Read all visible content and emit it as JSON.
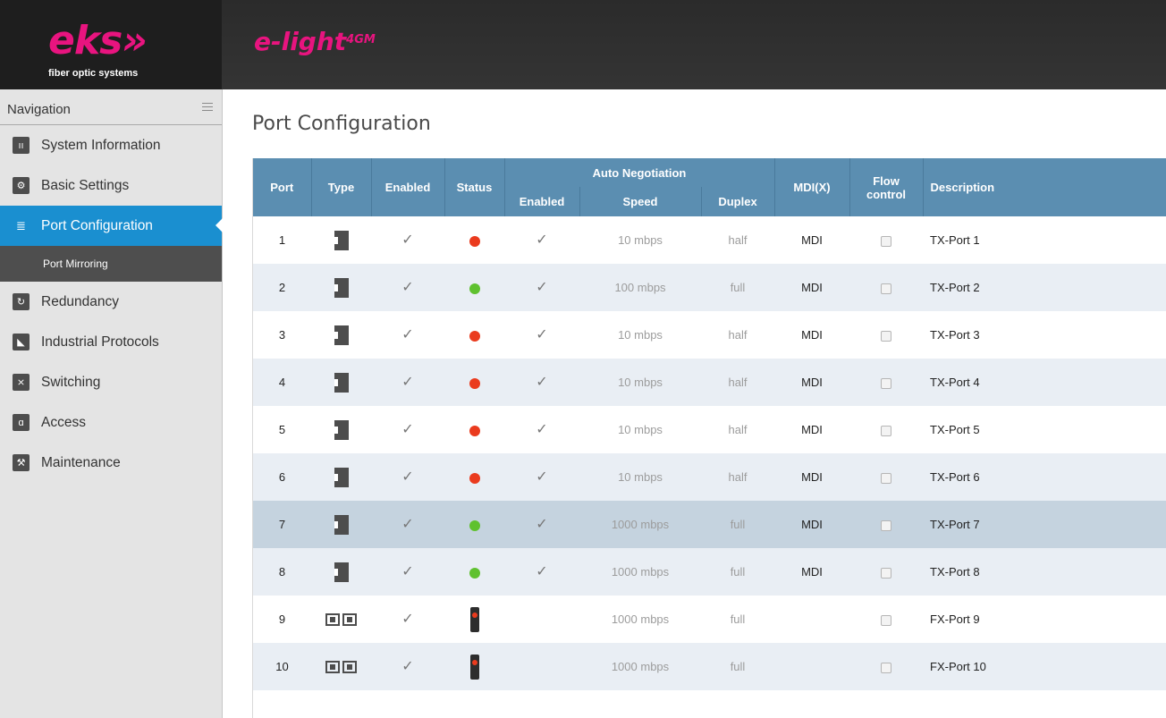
{
  "header": {
    "brand_logo": "eks»",
    "brand_subtitle": "fiber optic systems",
    "product_name": "e-light",
    "product_suffix": "4GM"
  },
  "sidebar": {
    "title": "Navigation",
    "items": [
      {
        "label": "System Information",
        "icon": "chart-icon"
      },
      {
        "label": "Basic Settings",
        "icon": "gear-icon"
      },
      {
        "label": "Port Configuration",
        "icon": "port-config-icon",
        "active": true
      },
      {
        "label": "Port Mirroring",
        "icon": "",
        "sub": true
      },
      {
        "label": "Redundancy",
        "icon": "redundancy-icon"
      },
      {
        "label": "Industrial Protocols",
        "icon": "protocols-icon"
      },
      {
        "label": "Switching",
        "icon": "switching-icon"
      },
      {
        "label": "Access",
        "icon": "lock-icon"
      },
      {
        "label": "Maintenance",
        "icon": "wrench-icon"
      }
    ]
  },
  "main": {
    "title": "Port Configuration",
    "columns": {
      "port": "Port",
      "type": "Type",
      "enabled": "Enabled",
      "status": "Status",
      "auto_negotiation": "Auto Negotiation",
      "an_enabled": "Enabled",
      "speed": "Speed",
      "duplex": "Duplex",
      "mdix": "MDI(X)",
      "flow_line1": "Flow",
      "flow_line2": "control",
      "description": "Description"
    },
    "rows": [
      {
        "port": "1",
        "type": "TX",
        "enabled": true,
        "status": "down",
        "an_enabled": true,
        "speed": "10 mbps",
        "duplex": "half",
        "mdix": "MDI",
        "flow": false,
        "description": "TX-Port 1"
      },
      {
        "port": "2",
        "type": "TX",
        "enabled": true,
        "status": "up",
        "an_enabled": true,
        "speed": "100 mbps",
        "duplex": "full",
        "mdix": "MDI",
        "flow": false,
        "description": "TX-Port 2"
      },
      {
        "port": "3",
        "type": "TX",
        "enabled": true,
        "status": "down",
        "an_enabled": true,
        "speed": "10 mbps",
        "duplex": "half",
        "mdix": "MDI",
        "flow": false,
        "description": "TX-Port 3"
      },
      {
        "port": "4",
        "type": "TX",
        "enabled": true,
        "status": "down",
        "an_enabled": true,
        "speed": "10 mbps",
        "duplex": "half",
        "mdix": "MDI",
        "flow": false,
        "description": "TX-Port 4"
      },
      {
        "port": "5",
        "type": "TX",
        "enabled": true,
        "status": "down",
        "an_enabled": true,
        "speed": "10 mbps",
        "duplex": "half",
        "mdix": "MDI",
        "flow": false,
        "description": "TX-Port 5"
      },
      {
        "port": "6",
        "type": "TX",
        "enabled": true,
        "status": "down",
        "an_enabled": true,
        "speed": "10 mbps",
        "duplex": "half",
        "mdix": "MDI",
        "flow": false,
        "description": "TX-Port 6"
      },
      {
        "port": "7",
        "type": "TX",
        "enabled": true,
        "status": "up",
        "an_enabled": true,
        "speed": "1000 mbps",
        "duplex": "full",
        "mdix": "MDI",
        "flow": false,
        "description": "TX-Port 7",
        "selected": true
      },
      {
        "port": "8",
        "type": "TX",
        "enabled": true,
        "status": "up",
        "an_enabled": true,
        "speed": "1000 mbps",
        "duplex": "full",
        "mdix": "MDI",
        "flow": false,
        "description": "TX-Port 8"
      },
      {
        "port": "9",
        "type": "FX",
        "enabled": true,
        "status": "sfp",
        "an_enabled": null,
        "speed": "1000 mbps",
        "duplex": "full",
        "mdix": "",
        "flow": false,
        "description": "FX-Port 9"
      },
      {
        "port": "10",
        "type": "FX",
        "enabled": true,
        "status": "sfp",
        "an_enabled": null,
        "speed": "1000 mbps",
        "duplex": "full",
        "mdix": "",
        "flow": false,
        "description": "FX-Port 10"
      }
    ]
  },
  "colors": {
    "accent": "#1a8fd0",
    "brand": "#e8147f",
    "table_header": "#5b8eb1",
    "status_up": "#5fc12f",
    "status_down": "#ea3b1e"
  }
}
